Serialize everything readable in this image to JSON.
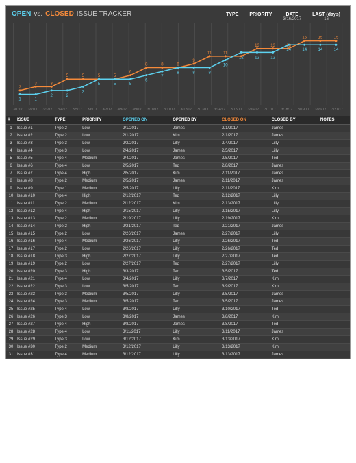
{
  "header": {
    "title_open": "OPEN",
    "title_vs": "vs.",
    "title_closed": "CLOSED",
    "title_tracker": "ISSUE TRACKER",
    "filters": [
      {
        "label": "TYPE",
        "value": "-"
      },
      {
        "label": "PRIORITY",
        "value": "-"
      },
      {
        "label": "DATE",
        "value": "3/16/2017"
      },
      {
        "label": "LAST (days)",
        "value": "16"
      }
    ]
  },
  "chart_data": {
    "type": "line",
    "x_dates": [
      "3/1/17",
      "3/2/17",
      "3/3/17",
      "3/4/17",
      "3/5/17",
      "3/6/17",
      "3/7/17",
      "3/8/17",
      "3/9/17",
      "3/10/17",
      "3/11/17",
      "3/12/17",
      "3/13/17",
      "3/14/17",
      "3/15/17",
      "3/16/17",
      "3/17/17",
      "3/18/17",
      "3/19/17",
      "3/20/17",
      "3/21/17"
    ],
    "series": [
      {
        "name": "Closed",
        "color": "#f58a3a",
        "values": [
          2,
          3,
          3,
          5,
          5,
          5,
          5,
          6,
          8,
          8,
          8,
          9,
          11,
          11,
          11,
          13,
          13,
          13,
          15,
          15,
          15
        ]
      },
      {
        "name": "Open",
        "color": "#5dd2f0",
        "values": [
          1,
          1,
          2,
          2,
          3,
          5,
          5,
          5,
          6,
          7,
          8,
          8,
          8,
          10,
          12,
          12,
          12,
          14,
          14,
          14,
          14
        ]
      }
    ],
    "ylim": [
      0,
      18
    ]
  },
  "table": {
    "headers": [
      "#",
      "ISSUE",
      "TYPE",
      "PRIORITY",
      "OPENED ON",
      "OPENED BY",
      "CLOSED ON",
      "CLOSED BY",
      "NOTES"
    ],
    "rows": [
      {
        "n": 1,
        "issue": "Issue #1",
        "type": "Type 2",
        "priority": "Low",
        "opened": "2/1/2017",
        "opener": "James",
        "closed": "2/1/2017",
        "closer": "James",
        "notes": ""
      },
      {
        "n": 2,
        "issue": "Issue #2",
        "type": "Type 2",
        "priority": "Low",
        "opened": "2/1/2017",
        "opener": "Kim",
        "closed": "2/1/2017",
        "closer": "James",
        "notes": ""
      },
      {
        "n": 3,
        "issue": "Issue #3",
        "type": "Type 3",
        "priority": "Low",
        "opened": "2/2/2017",
        "opener": "Lilly",
        "closed": "2/4/2017",
        "closer": "Lilly",
        "notes": ""
      },
      {
        "n": 4,
        "issue": "Issue #4",
        "type": "Type 3",
        "priority": "Low",
        "opened": "2/4/2017",
        "opener": "James",
        "closed": "2/5/2017",
        "closer": "Lilly",
        "notes": ""
      },
      {
        "n": 5,
        "issue": "Issue #5",
        "type": "Type 4",
        "priority": "Medium",
        "opened": "2/4/2017",
        "opener": "James",
        "closed": "2/5/2017",
        "closer": "Ted",
        "notes": ""
      },
      {
        "n": 6,
        "issue": "Issue #6",
        "type": "Type 4",
        "priority": "Low",
        "opened": "2/5/2017",
        "opener": "Ted",
        "closed": "2/8/2017",
        "closer": "James",
        "notes": ""
      },
      {
        "n": 7,
        "issue": "Issue #7",
        "type": "Type 4",
        "priority": "High",
        "opened": "2/5/2017",
        "opener": "Kim",
        "closed": "2/11/2017",
        "closer": "James",
        "notes": ""
      },
      {
        "n": 8,
        "issue": "Issue #8",
        "type": "Type 2",
        "priority": "Medium",
        "opened": "2/5/2017",
        "opener": "James",
        "closed": "2/11/2017",
        "closer": "James",
        "notes": ""
      },
      {
        "n": 9,
        "issue": "Issue #9",
        "type": "Type 1",
        "priority": "Medium",
        "opened": "2/5/2017",
        "opener": "Lilly",
        "closed": "2/11/2017",
        "closer": "Kim",
        "notes": ""
      },
      {
        "n": 10,
        "issue": "Issue #10",
        "type": "Type 4",
        "priority": "High",
        "opened": "2/12/2017",
        "opener": "Ted",
        "closed": "2/12/2017",
        "closer": "Lilly",
        "notes": ""
      },
      {
        "n": 11,
        "issue": "Issue #11",
        "type": "Type 2",
        "priority": "Medium",
        "opened": "2/12/2017",
        "opener": "Kim",
        "closed": "2/13/2017",
        "closer": "Lilly",
        "notes": ""
      },
      {
        "n": 12,
        "issue": "Issue #12",
        "type": "Type 4",
        "priority": "High",
        "opened": "2/15/2017",
        "opener": "Lilly",
        "closed": "2/15/2017",
        "closer": "Lilly",
        "notes": ""
      },
      {
        "n": 13,
        "issue": "Issue #13",
        "type": "Type 2",
        "priority": "Medium",
        "opened": "2/19/2017",
        "opener": "Lilly",
        "closed": "2/19/2017",
        "closer": "Kim",
        "notes": ""
      },
      {
        "n": 14,
        "issue": "Issue #14",
        "type": "Type 2",
        "priority": "High",
        "opened": "2/21/2017",
        "opener": "Ted",
        "closed": "2/21/2017",
        "closer": "James",
        "notes": ""
      },
      {
        "n": 15,
        "issue": "Issue #15",
        "type": "Type 2",
        "priority": "Low",
        "opened": "2/26/2017",
        "opener": "James",
        "closed": "2/27/2017",
        "closer": "Lilly",
        "notes": ""
      },
      {
        "n": 16,
        "issue": "Issue #16",
        "type": "Type 4",
        "priority": "Medium",
        "opened": "2/26/2017",
        "opener": "Lilly",
        "closed": "2/26/2017",
        "closer": "Ted",
        "notes": ""
      },
      {
        "n": 17,
        "issue": "Issue #17",
        "type": "Type 2",
        "priority": "Low",
        "opened": "2/26/2017",
        "opener": "Lilly",
        "closed": "2/26/2017",
        "closer": "Ted",
        "notes": ""
      },
      {
        "n": 18,
        "issue": "Issue #18",
        "type": "Type 3",
        "priority": "High",
        "opened": "2/27/2017",
        "opener": "Lilly",
        "closed": "2/27/2017",
        "closer": "Ted",
        "notes": ""
      },
      {
        "n": 19,
        "issue": "Issue #19",
        "type": "Type 2",
        "priority": "Low",
        "opened": "2/27/2017",
        "opener": "Ted",
        "closed": "2/27/2017",
        "closer": "Lilly",
        "notes": ""
      },
      {
        "n": 20,
        "issue": "Issue #20",
        "type": "Type 3",
        "priority": "High",
        "opened": "3/3/2017",
        "opener": "Ted",
        "closed": "3/5/2017",
        "closer": "Ted",
        "notes": ""
      },
      {
        "n": 21,
        "issue": "Issue #21",
        "type": "Type 4",
        "priority": "Low",
        "opened": "3/4/2017",
        "opener": "Lilly",
        "closed": "3/7/2017",
        "closer": "Kim",
        "notes": ""
      },
      {
        "n": 22,
        "issue": "Issue #22",
        "type": "Type 3",
        "priority": "Low",
        "opened": "3/5/2017",
        "opener": "Ted",
        "closed": "3/9/2017",
        "closer": "Kim",
        "notes": ""
      },
      {
        "n": 23,
        "issue": "Issue #23",
        "type": "Type 3",
        "priority": "Medium",
        "opened": "3/5/2017",
        "opener": "Lilly",
        "closed": "3/5/2017",
        "closer": "James",
        "notes": ""
      },
      {
        "n": 24,
        "issue": "Issue #24",
        "type": "Type 3",
        "priority": "Medium",
        "opened": "3/5/2017",
        "opener": "Ted",
        "closed": "3/5/2017",
        "closer": "James",
        "notes": ""
      },
      {
        "n": 25,
        "issue": "Issue #25",
        "type": "Type 4",
        "priority": "Low",
        "opened": "3/8/2017",
        "opener": "Lilly",
        "closed": "3/10/2017",
        "closer": "Ted",
        "notes": ""
      },
      {
        "n": 26,
        "issue": "Issue #26",
        "type": "Type 3",
        "priority": "Low",
        "opened": "3/8/2017",
        "opener": "James",
        "closed": "3/8/2017",
        "closer": "Kim",
        "notes": ""
      },
      {
        "n": 27,
        "issue": "Issue #27",
        "type": "Type 4",
        "priority": "High",
        "opened": "3/8/2017",
        "opener": "James",
        "closed": "3/8/2017",
        "closer": "Ted",
        "notes": ""
      },
      {
        "n": 28,
        "issue": "Issue #28",
        "type": "Type 4",
        "priority": "Low",
        "opened": "3/11/2017",
        "opener": "Lilly",
        "closed": "3/11/2017",
        "closer": "James",
        "notes": ""
      },
      {
        "n": 29,
        "issue": "Issue #29",
        "type": "Type 3",
        "priority": "Low",
        "opened": "3/12/2017",
        "opener": "Kim",
        "closed": "3/13/2017",
        "closer": "Kim",
        "notes": ""
      },
      {
        "n": 30,
        "issue": "Issue #30",
        "type": "Type 2",
        "priority": "Medium",
        "opened": "3/12/2017",
        "opener": "Lilly",
        "closed": "3/13/2017",
        "closer": "Kim",
        "notes": ""
      },
      {
        "n": 31,
        "issue": "Issue #31",
        "type": "Type 4",
        "priority": "Medium",
        "opened": "3/12/2017",
        "opener": "Lilly",
        "closed": "3/13/2017",
        "closer": "James",
        "notes": ""
      }
    ]
  }
}
